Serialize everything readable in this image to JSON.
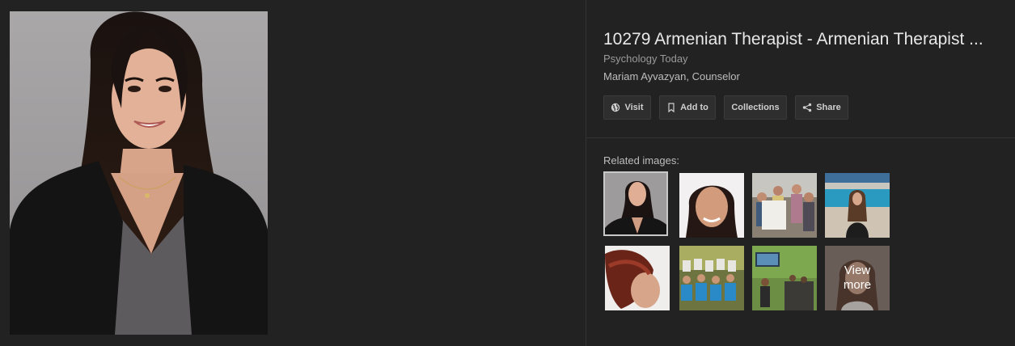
{
  "result": {
    "title": "10279 Armenian Therapist - Armenian Therapist ...",
    "source": "Psychology Today",
    "description": "Mariam Ayvazyan, Counselor"
  },
  "actions": [
    {
      "label": "Visit",
      "icon": "globe-icon"
    },
    {
      "label": "Add to",
      "icon": "bookmark-icon"
    },
    {
      "label": "Collections",
      "icon": ""
    },
    {
      "label": "Share",
      "icon": "share-icon"
    }
  ],
  "related": {
    "label": "Related images:",
    "more_line1": "View",
    "more_line2": "more"
  },
  "colors": {
    "background": "#222222",
    "button_bg": "#2e2e2e",
    "title_text": "#e8e8e8"
  }
}
